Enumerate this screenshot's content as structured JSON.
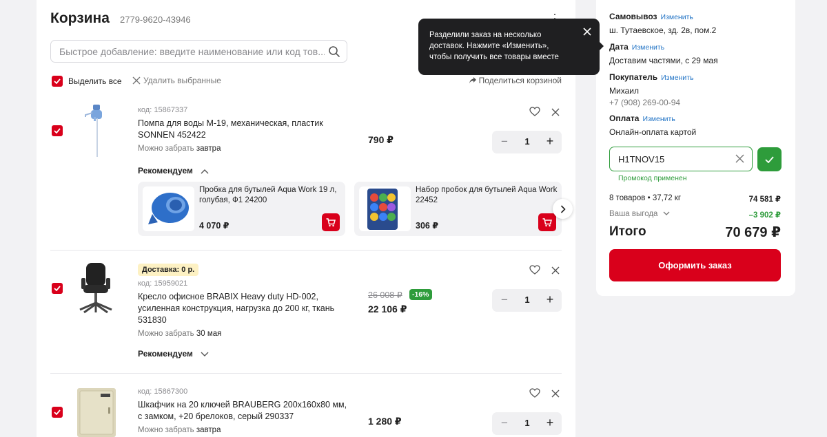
{
  "cart": {
    "title": "Корзина",
    "id": "2779-9620-43946",
    "search_placeholder": "Быстрое добавление: введите наименование или код тов...",
    "select_all": "Выделить все",
    "delete_selected": "Удалить выбранные",
    "share": "Поделиться корзиной"
  },
  "tooltip": {
    "text": "Разделили заказ на несколько доставок. Нажмите «Изменить», чтобы получить все товары вместе"
  },
  "items": [
    {
      "code": "код: 15867337",
      "name": "Помпа для воды М-19, механическая, пластик SONNEN 452422",
      "pickup_prefix": "Можно забрать",
      "pickup_when": "завтра",
      "price": "790 ₽",
      "qty": "1",
      "reco_label": "Рекомендуем",
      "recommendations": [
        {
          "name": "Пробка для бутылей Aqua Work 19 л, голубая, Ф1 24200",
          "price": "4 070 ₽"
        },
        {
          "name": "Набор пробок для бутылей Aqua Work 22452",
          "price": "306 ₽"
        }
      ]
    },
    {
      "delivery_badge": "Доставка: 0 р.",
      "code": "код: 15959021",
      "name": "Кресло офисное BRABIX Heavy duty HD-002, усиленная конструкция, нагрузка до 200 кг, ткань 531830",
      "pickup_prefix": "Можно забрать",
      "pickup_when": "30 мая",
      "old_price": "26 008 ₽",
      "discount": "-16%",
      "price": "22 106 ₽",
      "qty": "1",
      "reco_label": "Рекомендуем"
    },
    {
      "code": "код: 15867300",
      "name": "Шкафчик на 20 ключей BRAUBERG 200х160х80 мм, с замком, +20 брелоков, серый 290337",
      "pickup_prefix": "Можно забрать",
      "pickup_when": "завтра",
      "price": "1 280 ₽",
      "qty": "1"
    }
  ],
  "summary": {
    "change_link": "Изменить",
    "pickup_label": "Самовывоз",
    "pickup_address": "ш. Тутаевское, зд. 2в, пом.2",
    "date_label": "Дата",
    "date_value": "Доставим частями, с 29 мая",
    "buyer_label": "Покупатель",
    "buyer_name": "Михаил",
    "buyer_phone": "+7 (908) 269-00-94",
    "payment_label": "Оплата",
    "payment_value": "Онлайн-оплата картой",
    "promo_code": "H1TNOV15",
    "promo_applied": "Промокод применен",
    "items_count": "8 товаров • 37,72 кг",
    "items_sum": "74 581 ₽",
    "benefit_label": "Ваша выгода",
    "benefit_value": "–3 902 ₽",
    "total_label": "Итого",
    "total_value": "70 679 ₽",
    "checkout_label": "Оформить заказ"
  },
  "colors": {
    "accent": "#d9001b",
    "success": "#2e9c3b",
    "link": "#2475c6",
    "tooltip_bg": "#1f1f21"
  }
}
